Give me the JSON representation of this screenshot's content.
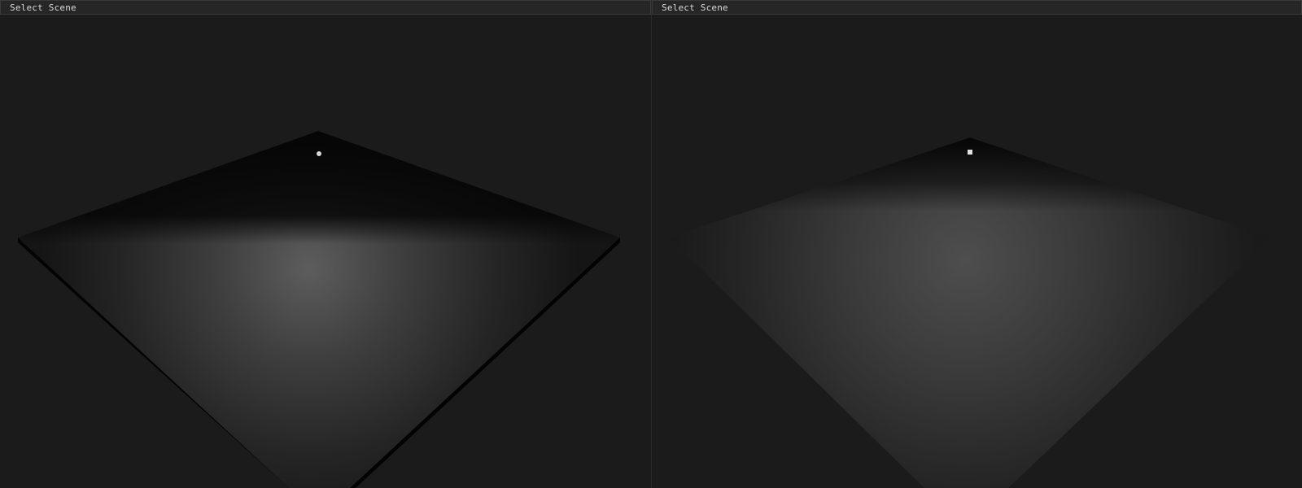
{
  "viewports": [
    {
      "menu": {
        "label": "Select Scene"
      },
      "scene": {
        "background": "#1b1b1b",
        "floor_color": "#0a0a0a",
        "light_color": "#5a5a5a",
        "light_marker": "circle"
      }
    },
    {
      "menu": {
        "label": "Select Scene"
      },
      "scene": {
        "background": "#1b1b1b",
        "floor_color": "#0a0a0a",
        "light_color": "#505050",
        "light_marker": "square"
      }
    }
  ]
}
